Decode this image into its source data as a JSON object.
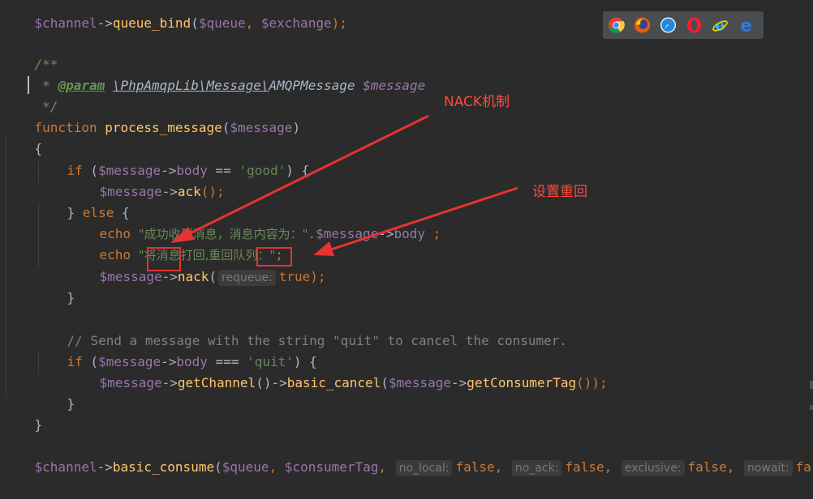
{
  "code": {
    "l0": {
      "t1": "$channel",
      "t2": "->",
      "t3": "queue_bind",
      "t4": "(",
      "t5": "$queue",
      "t6": ", ",
      "t7": "$exchange",
      "t8": ");"
    },
    "l1": {
      "t1": "/**"
    },
    "l2": {
      "t1": " * ",
      "t2": "@param",
      "t3": " ",
      "t4": "\\PhpAmqpLib\\Message\\",
      "t5": "AMQPMessage",
      "t6": " ",
      "t7": "$message"
    },
    "l3": {
      "t1": " */"
    },
    "l4": {
      "t1": "function",
      "t2": " ",
      "t3": "process_message",
      "t4": "(",
      "t5": "$message",
      "t6": ")"
    },
    "l5": {
      "t1": "{"
    },
    "l6": {
      "t1": "if",
      "t2": " (",
      "t3": "$message",
      "t4": "->",
      "t5": "body",
      "t6": " == ",
      "t7": "'good'",
      "t8": ") {"
    },
    "l7": {
      "t1": "$message",
      "t2": "->",
      "t3": "ack",
      "t4": "();"
    },
    "l8": {
      "t1": "} ",
      "t2": "else",
      "t3": " {"
    },
    "l9": {
      "t1": "echo",
      "t2": " ",
      "t3": "\"成功收到消息，消息内容为：\"",
      "t4": ".",
      "t5": "$message",
      "t6": "->",
      "t7": "body",
      "t8": " ;"
    },
    "l10": {
      "t1": "echo",
      "t2": " ",
      "t3": "\"将消息打回,重回队列：\"",
      "t4": ";"
    },
    "l11": {
      "t1": "$message",
      "t2": "->",
      "t3": "nack",
      "t4": "(",
      "hint": "requeue:",
      "t5": "true",
      "t6": ");"
    },
    "l12": {
      "t1": "}"
    },
    "l13": {
      "t1": ""
    },
    "l14": {
      "t1": "// Send a message with the string \"quit\" to cancel the consumer."
    },
    "l15": {
      "t1": "if",
      "t2": " (",
      "t3": "$message",
      "t4": "->",
      "t5": "body",
      "t6": " === ",
      "t7": "'quit'",
      "t8": ") {"
    },
    "l16": {
      "t1": "$message",
      "t2": "->",
      "t3": "getChannel",
      "t4": "()->",
      "t5": "basic_cancel",
      "t6": "(",
      "t7": "$message",
      "t8": "->",
      "t9": "getConsumerTag",
      "t10": "());"
    },
    "l17": {
      "t1": "}"
    },
    "l18": {
      "t1": "}"
    },
    "l19": {
      "t1": ""
    },
    "l20": {
      "t1": "$channel",
      "t2": "->",
      "t3": "basic_consume",
      "t4": "(",
      "t5": "$queue",
      "t6": ", ",
      "t7": "$consumerTag",
      "t8": ", ",
      "h1": "no_local:",
      "t9": "false",
      "t10": ", ",
      "h2": "no_ack:",
      "t11": "false",
      "t12": ", ",
      "h3": "exclusive:",
      "t13": "false",
      "t14": ", ",
      "h4": "nowait:",
      "t15": "fa"
    }
  },
  "browsers": [
    "chrome-icon",
    "firefox-icon",
    "safari-icon",
    "opera-icon",
    "ie-icon",
    "edge-icon"
  ],
  "annotations": {
    "nack_label": "NACK机制",
    "requeue_label": "设置重回"
  },
  "colors": {
    "background": "#2b2b2b",
    "keyword": "#cc7832",
    "variable": "#9876aa",
    "function": "#ffc66d",
    "string": "#6a8759",
    "comment": "#808080",
    "annotation": "#e53333"
  }
}
